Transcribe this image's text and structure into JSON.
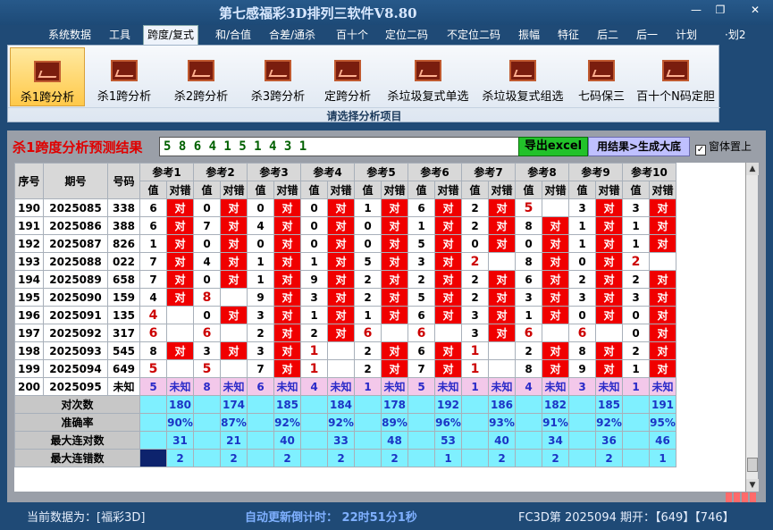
{
  "app_title": "第七感福彩3D排列三软件V8.80",
  "menu": [
    "系统数据",
    "工具",
    "跨度/复式",
    "和/合值",
    "合差/通杀",
    "百十个",
    "定位二码",
    "不定位二码",
    "振幅",
    "特征",
    "后二",
    "后一",
    "计划",
    "·划2"
  ],
  "ribbon": {
    "buttons": [
      "杀1跨分析",
      "杀1跨分析",
      "杀2跨分析",
      "杀3跨分析",
      "定跨分析",
      "杀垃圾复式单选",
      "杀垃圾复式组选",
      "七码保三",
      "百十个N码定胆"
    ],
    "caption": "请选择分析项目"
  },
  "result": {
    "label": "杀1跨度分析预测结果",
    "value": "5 8 6 4 1 5 1 4 3 1",
    "excel_btn": "导出excel",
    "gen_btn": "用结果>生成大底",
    "topmost_label": "窗体置上",
    "topmost_mark": "✓"
  },
  "table": {
    "headers": {
      "seq": "序号",
      "period": "期号",
      "number": "号码",
      "val": "值",
      "check": "对错",
      "correct_mark": "对"
    },
    "refs": [
      "参考1",
      "参考2",
      "参考3",
      "参考4",
      "参考5",
      "参考6",
      "参考7",
      "参考8",
      "参考9",
      "参考10"
    ],
    "rows": [
      {
        "seq": "190",
        "period": "2025085",
        "number": "338",
        "cells": [
          [
            "6",
            1
          ],
          [
            "0",
            1
          ],
          [
            "0",
            1
          ],
          [
            "0",
            1
          ],
          [
            "1",
            1
          ],
          [
            "6",
            1
          ],
          [
            "2",
            1
          ],
          [
            "5",
            0
          ],
          [
            "3",
            1
          ],
          [
            "3",
            1
          ]
        ]
      },
      {
        "seq": "191",
        "period": "2025086",
        "number": "388",
        "cells": [
          [
            "6",
            1
          ],
          [
            "7",
            1
          ],
          [
            "4",
            1
          ],
          [
            "0",
            1
          ],
          [
            "0",
            1
          ],
          [
            "1",
            1
          ],
          [
            "2",
            1
          ],
          [
            "8",
            1
          ],
          [
            "1",
            1
          ],
          [
            "1",
            1
          ]
        ]
      },
      {
        "seq": "192",
        "period": "2025087",
        "number": "826",
        "cells": [
          [
            "1",
            1
          ],
          [
            "0",
            1
          ],
          [
            "0",
            1
          ],
          [
            "0",
            1
          ],
          [
            "0",
            1
          ],
          [
            "5",
            1
          ],
          [
            "0",
            1
          ],
          [
            "0",
            1
          ],
          [
            "1",
            1
          ],
          [
            "1",
            1
          ]
        ]
      },
      {
        "seq": "193",
        "period": "2025088",
        "number": "022",
        "cells": [
          [
            "7",
            1
          ],
          [
            "4",
            1
          ],
          [
            "1",
            1
          ],
          [
            "1",
            1
          ],
          [
            "5",
            1
          ],
          [
            "3",
            1
          ],
          [
            "2",
            0
          ],
          [
            "8",
            1
          ],
          [
            "0",
            1
          ],
          [
            "2",
            0
          ]
        ]
      },
      {
        "seq": "194",
        "period": "2025089",
        "number": "658",
        "cells": [
          [
            "7",
            1
          ],
          [
            "0",
            1
          ],
          [
            "1",
            1
          ],
          [
            "9",
            1
          ],
          [
            "2",
            1
          ],
          [
            "2",
            1
          ],
          [
            "2",
            1
          ],
          [
            "6",
            1
          ],
          [
            "2",
            1
          ],
          [
            "2",
            1
          ]
        ]
      },
      {
        "seq": "195",
        "period": "2025090",
        "number": "159",
        "cells": [
          [
            "4",
            1
          ],
          [
            "8",
            0
          ],
          [
            "9",
            1
          ],
          [
            "3",
            1
          ],
          [
            "2",
            1
          ],
          [
            "5",
            1
          ],
          [
            "2",
            1
          ],
          [
            "3",
            1
          ],
          [
            "3",
            1
          ],
          [
            "3",
            1
          ]
        ]
      },
      {
        "seq": "196",
        "period": "2025091",
        "number": "135",
        "cells": [
          [
            "4",
            0
          ],
          [
            "0",
            1
          ],
          [
            "3",
            1
          ],
          [
            "1",
            1
          ],
          [
            "1",
            1
          ],
          [
            "6",
            1
          ],
          [
            "3",
            1
          ],
          [
            "1",
            1
          ],
          [
            "0",
            1
          ],
          [
            "0",
            1
          ]
        ]
      },
      {
        "seq": "197",
        "period": "2025092",
        "number": "317",
        "cells": [
          [
            "6",
            0
          ],
          [
            "6",
            0
          ],
          [
            "2",
            1
          ],
          [
            "2",
            1
          ],
          [
            "6",
            0
          ],
          [
            "6",
            0
          ],
          [
            "3",
            1
          ],
          [
            "6",
            0
          ],
          [
            "6",
            0
          ],
          [
            "0",
            1
          ]
        ]
      },
      {
        "seq": "198",
        "period": "2025093",
        "number": "545",
        "cells": [
          [
            "8",
            1
          ],
          [
            "3",
            1
          ],
          [
            "3",
            1
          ],
          [
            "1",
            0
          ],
          [
            "2",
            1
          ],
          [
            "6",
            1
          ],
          [
            "1",
            0
          ],
          [
            "2",
            1
          ],
          [
            "8",
            1
          ],
          [
            "2",
            1
          ]
        ]
      },
      {
        "seq": "199",
        "period": "2025094",
        "number": "649",
        "cells": [
          [
            "5",
            0
          ],
          [
            "5",
            0
          ],
          [
            "7",
            1
          ],
          [
            "1",
            0
          ],
          [
            "2",
            1
          ],
          [
            "7",
            1
          ],
          [
            "1",
            0
          ],
          [
            "8",
            1
          ],
          [
            "9",
            1
          ],
          [
            "1",
            1
          ]
        ]
      }
    ],
    "pending_row": {
      "seq": "200",
      "period": "2025095",
      "number": "未知",
      "values": [
        "5",
        "8",
        "6",
        "4",
        "1",
        "5",
        "1",
        "4",
        "3",
        "1"
      ],
      "unknown": "未知"
    },
    "stats": [
      {
        "label": "对次数",
        "values": [
          "180",
          "174",
          "185",
          "184",
          "178",
          "192",
          "186",
          "182",
          "185",
          "191"
        ]
      },
      {
        "label": "准确率",
        "values": [
          "90%",
          "87%",
          "92%",
          "92%",
          "89%",
          "96%",
          "93%",
          "91%",
          "92%",
          "95%"
        ]
      },
      {
        "label": "最大连对数",
        "values": [
          "31",
          "21",
          "40",
          "33",
          "48",
          "53",
          "40",
          "34",
          "36",
          "46"
        ]
      },
      {
        "label": "最大连错数",
        "values": [
          "2",
          "2",
          "2",
          "2",
          "2",
          "1",
          "2",
          "2",
          "2",
          "1"
        ]
      }
    ]
  },
  "status": {
    "current_data": "当前数据为：[福彩3D]",
    "countdown": "自动更新倒计时：  22时51分1秒",
    "draw_info": "FC3D第 2025094 期开：【649】【746】"
  }
}
